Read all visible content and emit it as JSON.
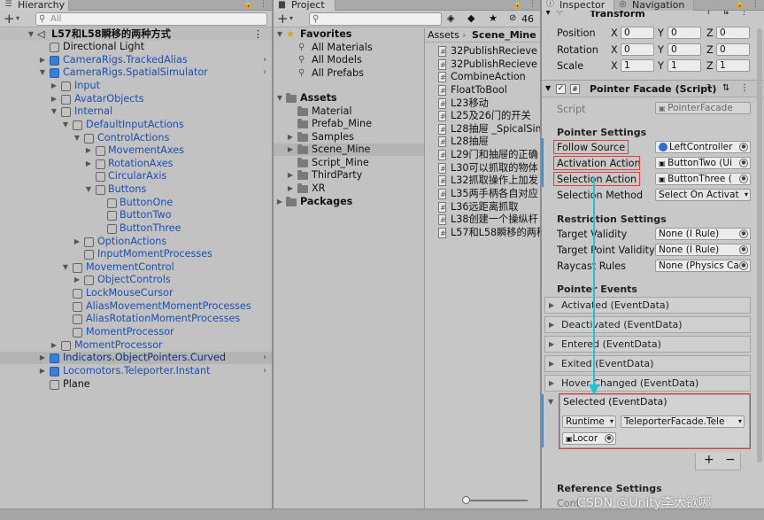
{
  "hierarchy": {
    "tab_label": "Hierarchy",
    "search_placeholder": "All",
    "items": [
      {
        "label": "L57和L58瞬移的两种方式"
      },
      {
        "label": "Directional Light"
      },
      {
        "label": "CameraRigs.TrackedAlias"
      },
      {
        "label": "CameraRigs.SpatialSimulator"
      },
      {
        "label": "Input"
      },
      {
        "label": "AvatarObjects"
      },
      {
        "label": "Internal"
      },
      {
        "label": "DefaultInputActions"
      },
      {
        "label": "ControlActions"
      },
      {
        "label": "MovementAxes"
      },
      {
        "label": "RotationAxes"
      },
      {
        "label": "CircularAxis"
      },
      {
        "label": "Buttons"
      },
      {
        "label": "ButtonOne"
      },
      {
        "label": "ButtonTwo"
      },
      {
        "label": "ButtonThree"
      },
      {
        "label": "OptionActions"
      },
      {
        "label": "InputMomentProcesses"
      },
      {
        "label": "MovementControl"
      },
      {
        "label": "ObjectControls"
      },
      {
        "label": "LockMouseCursor"
      },
      {
        "label": "AliasMovementMomentProcesses"
      },
      {
        "label": "AliasRotationMomentProcesses"
      },
      {
        "label": "MomentProcessor"
      },
      {
        "label": "MomentProcessor"
      },
      {
        "label": "Indicators.ObjectPointers.Curved"
      },
      {
        "label": "Locomotors.Teleporter.Instant"
      },
      {
        "label": "Plane"
      }
    ]
  },
  "project": {
    "tab_label": "Project",
    "count_badge": "46",
    "favorites_label": "Favorites",
    "favorites": [
      "All Materials",
      "All Models",
      "All Prefabs"
    ],
    "assets_label": "Assets",
    "asset_folders": [
      "Material",
      "Prefab_Mine",
      "Samples",
      "Scene_Mine",
      "Script_Mine",
      "ThirdParty",
      "XR"
    ],
    "packages_label": "Packages",
    "breadcrumb": [
      "Assets",
      "Scene_Mine"
    ],
    "files": [
      "32PublishRecieve",
      "32PublishRecieve",
      "CombineAction",
      "FloatToBool",
      "L23移动",
      "L25及26门的开关",
      "L28抽屉 _SpicalSim",
      "L28抽屉",
      "L29门和抽屉的正确",
      "L30可以抓取的物体",
      "L32抓取操作上加发",
      "L35两手柄各自对应",
      "L36远距离抓取",
      "L38创建一个操纵杆",
      "L57和L58瞬移的两种"
    ]
  },
  "inspector": {
    "tab_label": "Inspector",
    "nav_tab_label": "Navigation",
    "transform_title": "Transform",
    "position_label": "Position",
    "rotation_label": "Rotation",
    "scale_label": "Scale",
    "axis_x": "X",
    "axis_y": "Y",
    "axis_z": "Z",
    "position": [
      "0",
      "0",
      "0"
    ],
    "rotation": [
      "0",
      "0",
      "0"
    ],
    "scale": [
      "1",
      "1",
      "1"
    ],
    "component_title": "Pointer Facade (Script)",
    "script_label": "Script",
    "script_value": "PointerFacade",
    "pointer_settings": "Pointer Settings",
    "follow_source_label": "Follow Source",
    "follow_source_value": "LeftController",
    "activation_action_label": "Activation Action",
    "activation_action_value": "ButtonTwo (Ui",
    "selection_action_label": "Selection Action",
    "selection_action_value": "ButtonThree (",
    "selection_method_label": "Selection Method",
    "selection_method_value": "Select On Activat",
    "restriction_settings": "Restriction Settings",
    "target_validity_label": "Target Validity",
    "target_validity_value": "None (I Rule)",
    "target_point_validity_label": "Target Point Validity",
    "target_point_validity_value": "None (I Rule)",
    "raycast_rules_label": "Raycast Rules",
    "raycast_rules_value": "None (Physics Ca",
    "pointer_events": "Pointer Events",
    "events": [
      "Activated (EventData)",
      "Deactivated (EventData)",
      "Entered (EventData)",
      "Exited (EventData)",
      "Hover Changed (EventData)"
    ],
    "selected_event": "Selected (EventData)",
    "runtime_value": "Runtime",
    "function_value": "TeleporterFacade.Tele",
    "object_value": "Locor",
    "plus_label": "+",
    "minus_label": "−",
    "reference_settings": "Reference Settings",
    "cutoff_label": "Cont"
  },
  "watermark": "CSDN @Unity李大欲哪"
}
